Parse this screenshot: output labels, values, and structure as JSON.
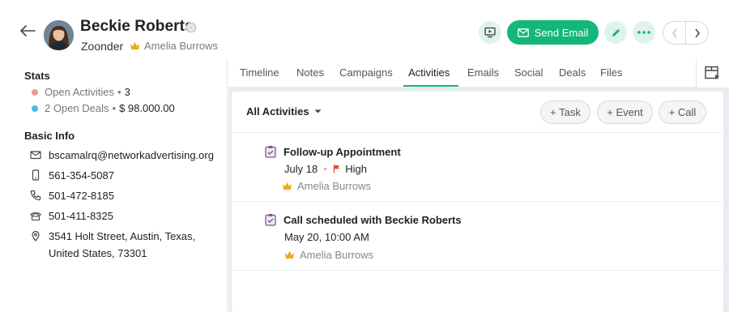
{
  "contact": {
    "name": "Beckie Roberts",
    "company": "Zoonder",
    "owner": "Amelia Burrows"
  },
  "header_actions": {
    "send_email_label": "Send Email"
  },
  "stats": {
    "heading": "Stats",
    "open_activities_label": "Open Activities",
    "open_activities_count": "3",
    "open_deals_label": "2 Open Deals",
    "open_deals_value": "$ 98.000.00",
    "activities_dot_color": "#f29a8e",
    "deals_dot_color": "#4fb9e3"
  },
  "basic_info": {
    "heading": "Basic Info",
    "email": "bscamalrq@networkadvertising.org",
    "mobile": "561-354-5087",
    "phone": "501-472-8185",
    "fax": "501-411-8325",
    "address_line1": "3541 Holt Street, Austin, Texas,",
    "address_line2": "United States, 73301"
  },
  "tabs": [
    "Timeline",
    "Notes",
    "Campaigns",
    "Activities",
    "Emails",
    "Social",
    "Deals",
    "Files"
  ],
  "active_tab": "Activities",
  "activities": {
    "filter_label": "All Activities",
    "add_task": "+ Task",
    "add_event": "+ Event",
    "add_call": "+ Call",
    "items": [
      {
        "title": "Follow-up Appointment",
        "date": "July 18",
        "priority": "High",
        "owner": "Amelia Burrows"
      },
      {
        "title": "Call scheduled with Beckie Roberts",
        "date": "May 20, 10:00 AM",
        "owner": "Amelia Burrows"
      }
    ]
  },
  "colors": {
    "accent": "#13b77a",
    "crown": "#f0a81a",
    "priority_flag": "#e5483f",
    "activity_icon": "#7b5a91"
  }
}
